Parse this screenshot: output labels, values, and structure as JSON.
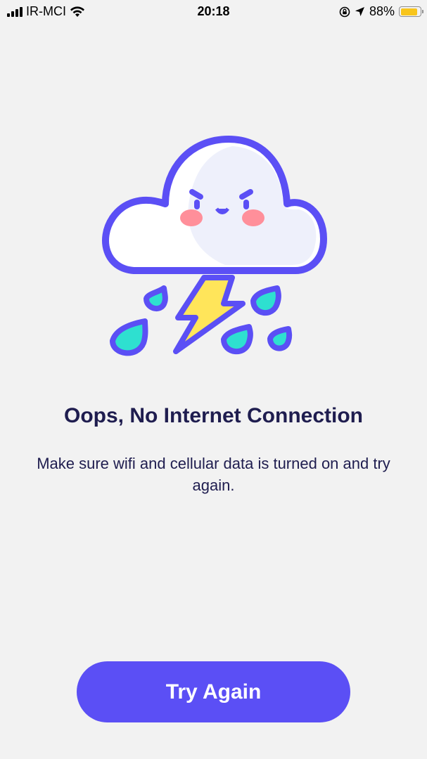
{
  "status_bar": {
    "carrier": "IR-MCI",
    "time": "20:18",
    "battery_percent": "88%",
    "battery_level": 0.88,
    "icons": [
      "signal-icon",
      "wifi-icon",
      "orientation-lock-icon",
      "location-arrow-icon",
      "battery-icon"
    ]
  },
  "error": {
    "illustration": "storm-cloud-icon",
    "title": "Oops, No Internet Connection",
    "message": "Make sure wifi and cellular data is turned on and try again."
  },
  "actions": {
    "retry_label": "Try Again"
  },
  "colors": {
    "background": "#f2f2f2",
    "accent": "#5b4ff5",
    "text": "#1f1d4f",
    "cloud_outline": "#5b4ff5",
    "raindrop": "#2ee0d0",
    "lightning": "#ffe55a",
    "blush": "#ff8f9a"
  }
}
